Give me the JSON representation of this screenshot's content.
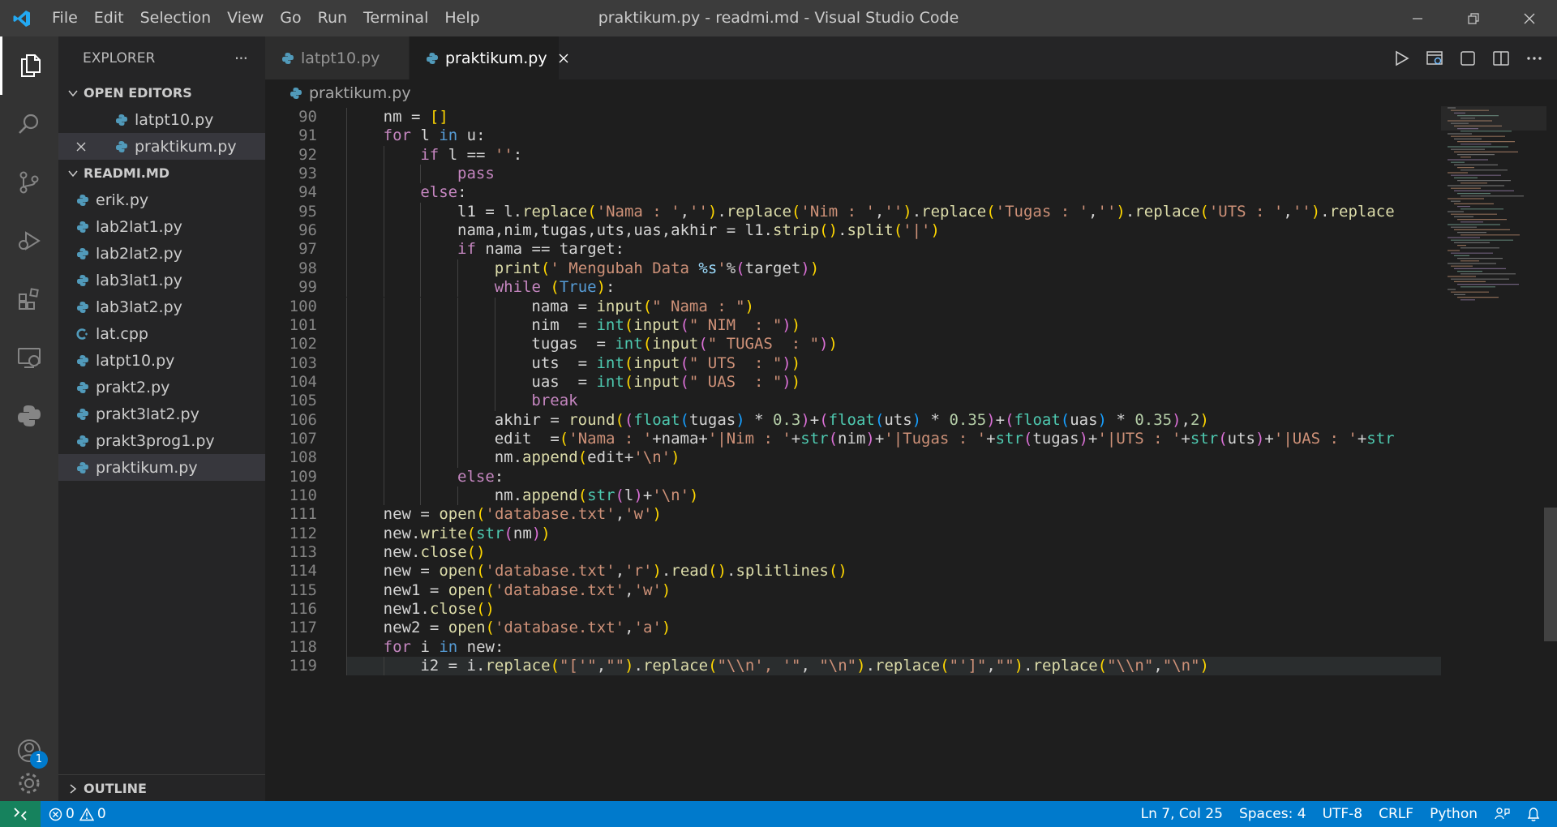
{
  "window": {
    "title": "praktikum.py - readmi.md - Visual Studio Code",
    "menu": [
      "File",
      "Edit",
      "Selection",
      "View",
      "Go",
      "Run",
      "Terminal",
      "Help"
    ]
  },
  "activity_bar": {
    "items": [
      "explorer-icon",
      "search-icon",
      "source-control-icon",
      "run-debug-icon",
      "extensions-icon",
      "remote-explorer-icon",
      "python-icon"
    ],
    "accounts_badge": "1"
  },
  "sidebar": {
    "title": "EXPLORER",
    "more": "···",
    "open_editors": {
      "title": "OPEN EDITORS",
      "files": [
        "latpt10.py",
        "praktikum.py"
      ]
    },
    "folder": {
      "title": "READMI.MD",
      "files": [
        "erik.py",
        "lab2lat1.py",
        "lab2lat2.py",
        "lab3lat1.py",
        "lab3lat2.py",
        "lat.cpp",
        "latpt10.py",
        "prakt2.py",
        "prakt3lat2.py",
        "prakt3prog1.py",
        "praktikum.py"
      ]
    },
    "outline_title": "OUTLINE"
  },
  "tabs": [
    {
      "label": "latpt10.py",
      "active": false
    },
    {
      "label": "praktikum.py",
      "active": true
    }
  ],
  "breadcrumb": "praktikum.py",
  "editor": {
    "line_numbers": [
      "90",
      "91",
      "92",
      "93",
      "94",
      "95",
      "96",
      "97",
      "98",
      "99",
      "100",
      "101",
      "102",
      "103",
      "104",
      "105",
      "106",
      "107",
      "108",
      "109",
      "110",
      "111",
      "112",
      "113",
      "114",
      "115",
      "116",
      "117",
      "118",
      "119"
    ]
  },
  "status_bar": {
    "errors": "0",
    "warnings": "0",
    "position": "Ln 7, Col 25",
    "spaces": "Spaces: 4",
    "encoding": "UTF-8",
    "eol": "CRLF",
    "language": "Python"
  },
  "colors": {
    "accent": "#007acc",
    "title_bar": "#3c3c3c",
    "activity_bar": "#333333",
    "sidebar": "#252526",
    "editor_bg": "#1e1e1e",
    "python_icon": "#519aba"
  }
}
